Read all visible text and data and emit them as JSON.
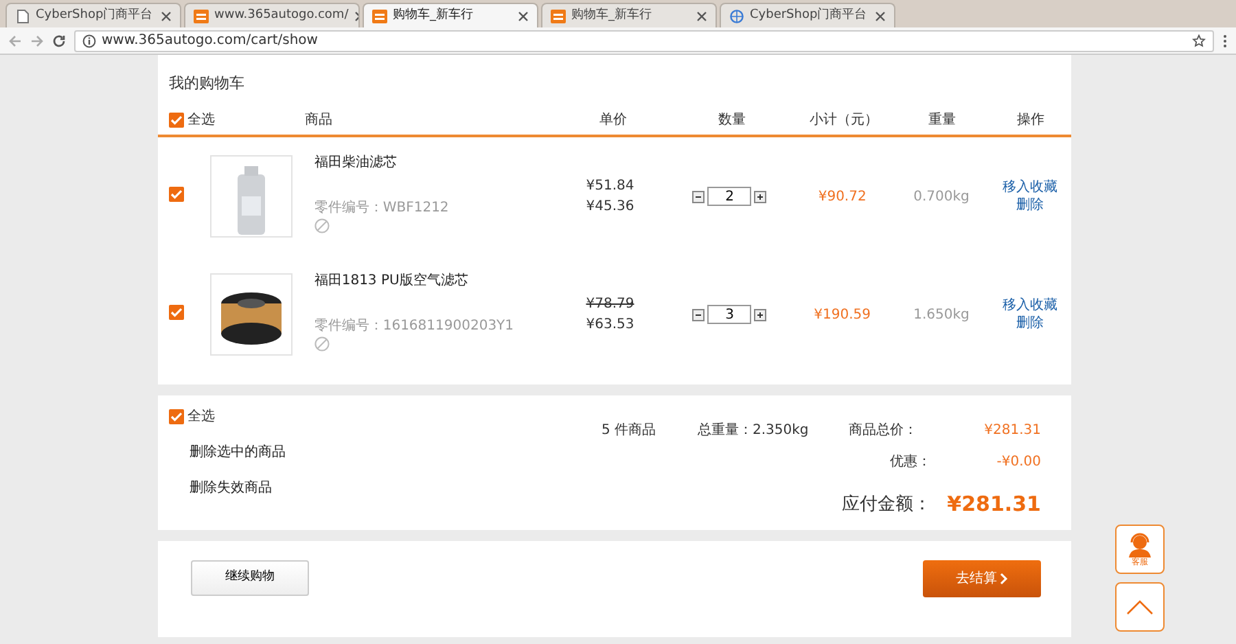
{
  "browser": {
    "tabs": [
      {
        "title": "CyberShop门商平台",
        "selected": false,
        "kind": "page"
      },
      {
        "title": "www.365autogo.com/",
        "selected": false,
        "kind": "logo"
      },
      {
        "title": "购物车_新车行",
        "selected": true,
        "kind": "logo"
      },
      {
        "title": "购物车_新车行",
        "selected": false,
        "kind": "logo"
      },
      {
        "title": "CyberShop门商平台",
        "selected": false,
        "kind": "globe"
      }
    ],
    "url": "www.365autogo.com/cart/show"
  },
  "cart": {
    "title": "我的购物车",
    "header": {
      "select_all": {
        "label": "全选",
        "checked": true
      },
      "columns": [
        "商品",
        "单价",
        "数量",
        "小计（元）",
        "重量",
        "操作"
      ]
    },
    "items": [
      {
        "checked": true,
        "name": "福田柴油滤芯",
        "part_no": "零件编号：WBF1212",
        "original_price": "¥51.84",
        "original_struck": false,
        "price": "¥45.36",
        "quantity": "2",
        "subtotal": "¥90.72",
        "weight": "0.700kg",
        "actions": [
          "移入收藏",
          "删除"
        ],
        "kind": "bottle"
      },
      {
        "checked": true,
        "name": "福田1813 PU版空气滤芯",
        "part_no": "零件编号：1616811900203Y1",
        "original_price": "¥78.79",
        "original_struck": true,
        "price": "¥63.53",
        "quantity": "3",
        "subtotal": "¥190.59",
        "weight": "1.650kg",
        "actions": [
          "移入收藏",
          "删除"
        ],
        "kind": "filter"
      }
    ],
    "summary": {
      "select_all": {
        "label": "全选",
        "checked": true
      },
      "links": [
        "删除选中的商品",
        "删除失效商品"
      ],
      "count": "5 件商品",
      "total_weight": "总重量：2.350kg",
      "goods_total_label": "商品总价：",
      "goods_total": "¥281.31",
      "discount_label": "优惠：",
      "discount": "-¥0.00",
      "payable_label": "应付金额：",
      "payable": "¥281.31"
    },
    "buttons": {
      "continue": "继续购物",
      "checkout": "去结算"
    }
  },
  "side": {
    "service_label": "客服"
  }
}
